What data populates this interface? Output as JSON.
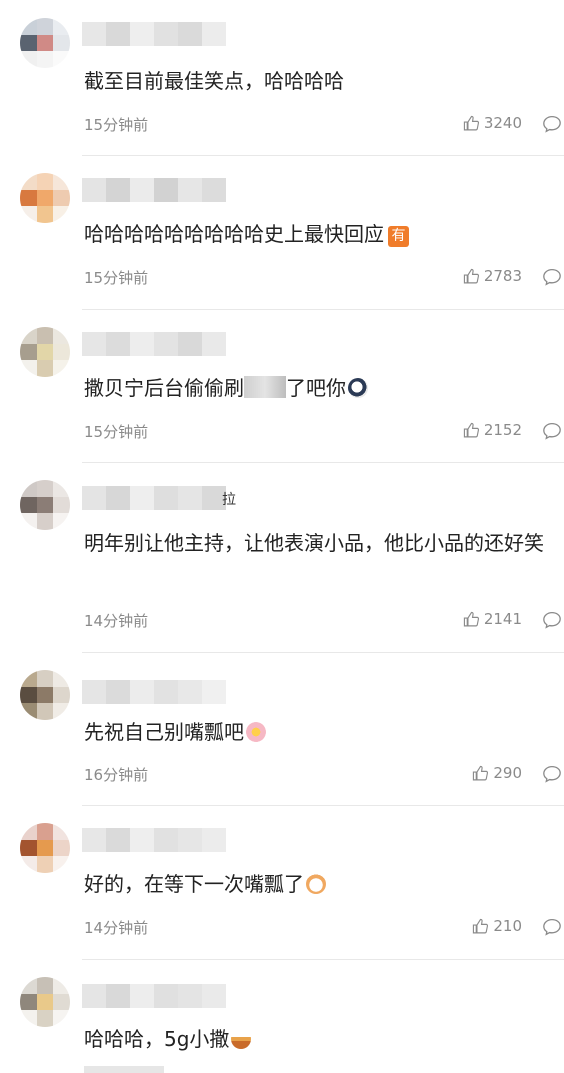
{
  "comments": [
    {
      "text": "截至目前最佳笑点，哈哈哈哈",
      "time": "15分钟前",
      "likes": "3240",
      "avatar_colors": [
        "#c9d0d8",
        "#cfd3da",
        "#e9ecf0",
        "#5a6370",
        "#d08a86",
        "#e3e6ea",
        "#f0f0f0",
        "#f4f4f4",
        "#fafafa"
      ],
      "name_colors": [
        "#e7e7e7",
        "#d9d9d9",
        "#eeeeee",
        "#e1e1e1",
        "#dadada",
        "#ececec"
      ]
    },
    {
      "text": "哈哈哈哈哈哈哈哈哈史上最快回应",
      "badge": "有",
      "time": "15分钟前",
      "likes": "2783",
      "avatar_colors": [
        "#f3dcc7",
        "#f5d3b5",
        "#f6e6d9",
        "#d8793f",
        "#f0a86a",
        "#eecbb0",
        "#f6efe9",
        "#f1c58f",
        "#f8f0e6"
      ],
      "name_colors": [
        "#e4e4e4",
        "#d4d4d4",
        "#ebebeb",
        "#d2d2d2",
        "#e6e6e6",
        "#dcdcdc"
      ]
    },
    {
      "text": "撒贝宁后台偷偷刷",
      "text_after": "了吧你",
      "time": "15分钟前",
      "likes": "2152",
      "avatar_colors": [
        "#d9d4c9",
        "#c9bfb0",
        "#ebe7df",
        "#a79e8e",
        "#e2d6a8",
        "#ece7da",
        "#f3f1ec",
        "#d9ccb0",
        "#f5f2ea"
      ],
      "name_colors": [
        "#e6e6e6",
        "#dcdcdc",
        "#ededed",
        "#e3e3e3",
        "#d9d9d9",
        "#e9e9e9"
      ]
    },
    {
      "name_suffix": "拉",
      "text": "明年别让他主持，让他表演小品，他比小品的还好笑",
      "time": "14分钟前",
      "likes": "2141",
      "avatar_colors": [
        "#cfc9c6",
        "#d6cfcb",
        "#ebe7e4",
        "#6f6560",
        "#8b7d76",
        "#e2dcd8",
        "#f4f1ef",
        "#d7cfca",
        "#f6f3f1"
      ],
      "name_colors": [
        "#e4e4e4",
        "#d7d7d7",
        "#eeeeee",
        "#dedede",
        "#e5e5e5",
        "#d9d9d9"
      ]
    },
    {
      "text": "先祝自己别嘴瓢吧",
      "time": "16分钟前",
      "likes": "290",
      "avatar_colors": [
        "#b9a98e",
        "#d7cfc3",
        "#eeeae4",
        "#5a4d40",
        "#8c7a67",
        "#ddd6cc",
        "#9a8c73",
        "#d1c7b8",
        "#f0ece6"
      ],
      "name_colors": [
        "#e5e5e5",
        "#dbdbdb",
        "#ececec",
        "#e2e2e2",
        "#e8e8e8",
        "#f0f0f0"
      ]
    },
    {
      "text": "好的，在等下一次嘴瓢了",
      "time": "14分钟前",
      "likes": "210",
      "avatar_colors": [
        "#e9d2cc",
        "#d9a08f",
        "#f1e3df",
        "#a3542f",
        "#e59a4e",
        "#ecd4c8",
        "#f4ebe8",
        "#eed0b5",
        "#f8f1ed"
      ],
      "name_colors": [
        "#e7e7e7",
        "#dadada",
        "#eeeeee",
        "#e1e1e1",
        "#e6e6e6",
        "#ececec"
      ]
    },
    {
      "text": "哈哈哈，5g小撒",
      "time": "",
      "likes": "",
      "avatar_colors": [
        "#dcd9d3",
        "#c7c0b6",
        "#eeebe6",
        "#8f877c",
        "#e9c98a",
        "#e0dbd3",
        "#f4f2ee",
        "#d9d2c4",
        "#f6f4f1"
      ],
      "name_colors": [
        "#e5e5e5",
        "#d9d9d9",
        "#ededed",
        "#e0e0e0",
        "#e4e4e4",
        "#eaeaea"
      ]
    }
  ],
  "icons": {
    "like": "thumbs-up-icon",
    "reply": "comment-bubble-icon"
  },
  "colors": {
    "meta": "#8a8a8a",
    "text": "#222222",
    "divider": "#e8e8e8",
    "badge": "#f07c2a"
  }
}
